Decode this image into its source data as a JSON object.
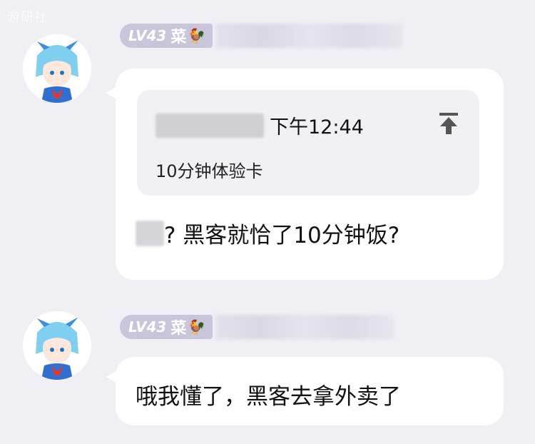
{
  "watermark": "游研社",
  "messages": [
    {
      "user": {
        "level": "LV43",
        "rank": "菜",
        "rank_icon": "chicken-icon",
        "avatar": "cirno-avatar"
      },
      "quote": {
        "time": "下午12:44",
        "text": "10分钟体验卡",
        "icon": "pin-top-icon"
      },
      "text": "? 黑客就恰了10分钟饭?"
    },
    {
      "user": {
        "level": "LV43",
        "rank": "菜",
        "rank_icon": "chicken-icon",
        "avatar": "cirno-avatar"
      },
      "text": "哦我懂了，黑客去拿外卖了"
    }
  ],
  "colors": {
    "background": "#efeff4",
    "bubble": "#ffffff",
    "quote": "#f1f1f4",
    "badge": "#c9c6dc"
  }
}
